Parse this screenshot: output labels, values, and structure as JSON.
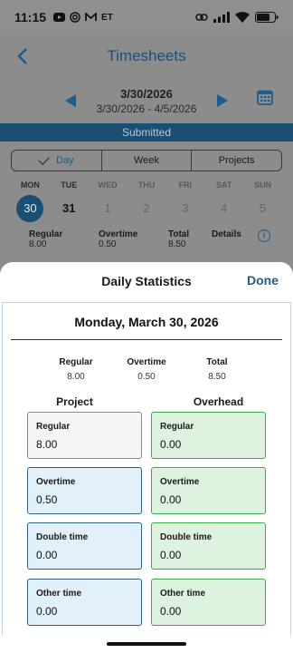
{
  "status_bar": {
    "time": "11:15",
    "left_icons": [
      "youtube-icon",
      "ring-icon",
      "mail-icon",
      "et-badge"
    ],
    "et_text": "ET",
    "right_icons": [
      "link-icon",
      "signal-icon",
      "wifi-icon",
      "battery-icon"
    ]
  },
  "header": {
    "title": "Timesheets"
  },
  "date_nav": {
    "date": "3/30/2026",
    "range": "3/30/2026 - 4/5/2026"
  },
  "status_strip": "Submitted",
  "view_tabs": [
    {
      "label": "Day",
      "selected": true
    },
    {
      "label": "Week",
      "selected": false
    },
    {
      "label": "Projects",
      "selected": false
    }
  ],
  "week_days": [
    {
      "name": "MON",
      "num": "30",
      "selected": true
    },
    {
      "name": "TUE",
      "num": "31"
    },
    {
      "name": "WED",
      "num": "1"
    },
    {
      "name": "THU",
      "num": "2"
    },
    {
      "name": "FRI",
      "num": "3"
    },
    {
      "name": "SAT",
      "num": "4"
    },
    {
      "name": "SUN",
      "num": "5"
    }
  ],
  "summary": {
    "regular_label": "Regular",
    "overtime_label": "Overtime",
    "total_label": "Total",
    "details_label": "Details",
    "regular": "8.00",
    "overtime": "0.50",
    "total": "8.50"
  },
  "sheet": {
    "title": "Daily Statistics",
    "done_label": "Done",
    "date_heading": "Monday, March 30, 2026",
    "totals": [
      {
        "label": "Regular",
        "value": "8.00"
      },
      {
        "label": "Overtime",
        "value": "0.50"
      },
      {
        "label": "Total",
        "value": "8.50"
      }
    ],
    "project_heading": "Project",
    "overhead_heading": "Overhead",
    "project_cards": [
      {
        "label": "Regular",
        "value": "8.00"
      },
      {
        "label": "Overtime",
        "value": "0.50"
      },
      {
        "label": "Double time",
        "value": "0.00"
      },
      {
        "label": "Other time",
        "value": "0.00"
      }
    ],
    "overhead_cards": [
      {
        "label": "Regular",
        "value": "0.00"
      },
      {
        "label": "Overtime",
        "value": "0.00"
      },
      {
        "label": "Double time",
        "value": "0.00"
      },
      {
        "label": "Other time",
        "value": "0.00"
      }
    ]
  },
  "colors": {
    "brand_blue": "#1d5e8f",
    "selected_day": "#1a4f73",
    "project_card_fill": "#e2f0f9",
    "overhead_card_fill": "#def3df"
  }
}
